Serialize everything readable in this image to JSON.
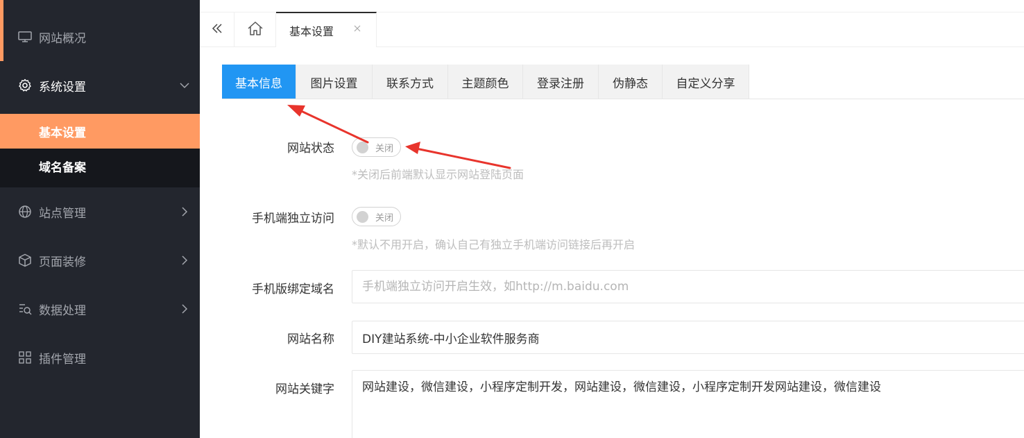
{
  "sidebar": {
    "items": [
      {
        "label": "网站概况",
        "icon": "monitor-icon"
      },
      {
        "label": "系统设置",
        "icon": "gear-icon",
        "expanded": true
      },
      {
        "label": "站点管理",
        "icon": "globe-icon"
      },
      {
        "label": "页面装修",
        "icon": "cube-icon"
      },
      {
        "label": "数据处理",
        "icon": "search-list-icon"
      },
      {
        "label": "插件管理",
        "icon": "grid-icon"
      }
    ],
    "submenu": [
      {
        "label": "基本设置",
        "selected": true
      },
      {
        "label": "域名备案",
        "selected": false
      }
    ]
  },
  "topbar": {
    "collapse_icon": "double-chevron-left-icon",
    "home_icon": "home-icon",
    "page_tab": "基本设置",
    "close_icon": "close-icon"
  },
  "subtabs": [
    {
      "label": "基本信息",
      "active": true
    },
    {
      "label": "图片设置"
    },
    {
      "label": "联系方式"
    },
    {
      "label": "主题颜色"
    },
    {
      "label": "登录注册"
    },
    {
      "label": "伪静态"
    },
    {
      "label": "自定义分享"
    }
  ],
  "form": {
    "site_status": {
      "label": "网站状态",
      "toggle_text": "关闭",
      "hint": "*关闭后前端默认显示网站登陆页面"
    },
    "mobile_access": {
      "label": "手机端独立访问",
      "toggle_text": "关闭",
      "hint": "*默认不用开启，确认自己有独立手机端访问链接后再开启"
    },
    "mobile_domain": {
      "label": "手机版绑定域名",
      "value": "",
      "placeholder": "手机端独立访问开启生效，如http://m.baidu.com"
    },
    "site_name": {
      "label": "网站名称",
      "value": "DIY建站系统-中小企业软件服务商"
    },
    "site_keywords": {
      "label": "网站关键字",
      "value": "网站建设，微信建设，小程序定制开发，网站建设，微信建设，小程序定制开发网站建设，微信建设"
    }
  },
  "colors": {
    "sidebar_bg": "#23262e",
    "accent_orange": "#ff9a62",
    "active_tab_blue": "#2196f3",
    "annotation_red": "#e8342c"
  }
}
